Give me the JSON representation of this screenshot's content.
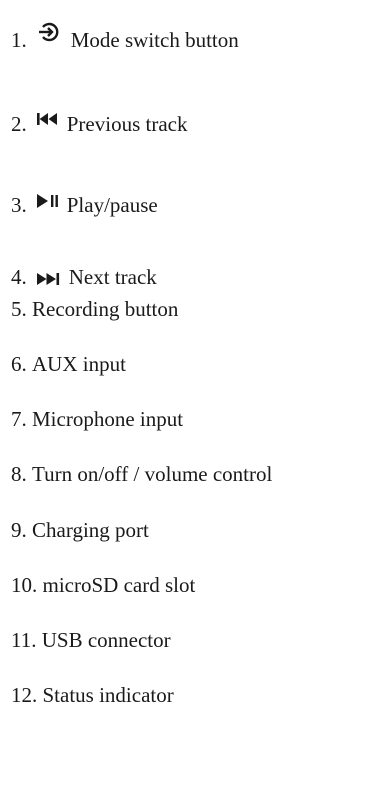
{
  "items": [
    {
      "number": "1.",
      "icon": "mode-switch-icon",
      "label": "Mode switch button"
    },
    {
      "number": "2.",
      "icon": "previous-track-icon",
      "label": "Previous track"
    },
    {
      "number": "3.",
      "icon": "play-pause-icon",
      "label": "Play/pause"
    },
    {
      "number": "4.",
      "icon": "next-track-icon",
      "label": "Next track"
    },
    {
      "number": "5.",
      "label": "Recording button"
    },
    {
      "number": "6.",
      "label": "AUX input"
    },
    {
      "number": "7.",
      "label": "Microphone input"
    },
    {
      "number": "8.",
      "label": "Turn on/off / volume control"
    },
    {
      "number": "9.",
      "label": "Charging port"
    },
    {
      "number": "10.",
      "label": "microSD card slot"
    },
    {
      "number": "11.",
      "label": "USB connector"
    },
    {
      "number": "12.",
      "label": "Status indicator"
    }
  ]
}
